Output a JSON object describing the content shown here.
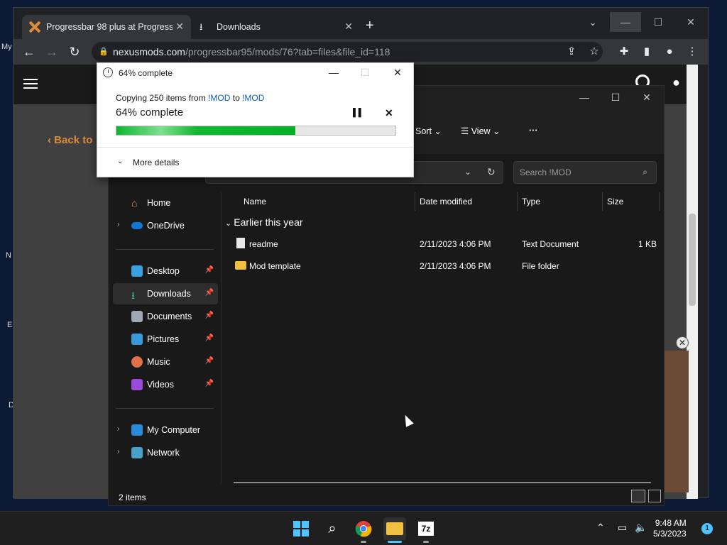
{
  "desktop": {
    "labels": [
      "My",
      "N",
      "E",
      "D"
    ]
  },
  "chrome": {
    "tabs": [
      {
        "title": "Progressbar 98 plus at Progressb",
        "active": true
      },
      {
        "title": "Downloads",
        "active": false
      }
    ],
    "new_tab": "+",
    "url_host": "nexusmods.com",
    "url_path": "/progressbar95/mods/76?tab=files&file_id=118"
  },
  "page": {
    "back_link": "Back to"
  },
  "explorer": {
    "commands": {
      "sort": "Sort",
      "view": "View",
      "more": "···"
    },
    "search_placeholder": "Search !MOD",
    "nav": {
      "home": "Home",
      "onedrive": "OneDrive",
      "desktop": "Desktop",
      "downloads": "Downloads",
      "documents": "Documents",
      "pictures": "Pictures",
      "music": "Music",
      "videos": "Videos",
      "my_computer": "My Computer",
      "network": "Network"
    },
    "columns": {
      "name": "Name",
      "date": "Date modified",
      "type": "Type",
      "size": "Size"
    },
    "group_label": "Earlier this year",
    "files": [
      {
        "name": "readme",
        "date": "2/11/2023 4:06 PM",
        "type": "Text Document",
        "size": "1 KB",
        "icon": "text-file-icon"
      },
      {
        "name": "Mod template",
        "date": "2/11/2023 4:06 PM",
        "type": "File folder",
        "size": "",
        "icon": "folder-icon"
      }
    ],
    "status": "2 items"
  },
  "copy_dialog": {
    "title": "64% complete",
    "copy_prefix": "Copying 250 items from ",
    "source": "!MOD",
    "to_word": " to ",
    "dest": "!MOD",
    "percent_label": "64% complete",
    "progress": 0.64,
    "more_details": "More details"
  },
  "taskbar": {
    "time": "9:48 AM",
    "date": "5/3/2023",
    "notification_count": "1",
    "sevenzip_label": "7z"
  },
  "colors": {
    "progress_green": "#06b025",
    "accent": "#4cc2ff",
    "link": "#0b5fb5"
  }
}
